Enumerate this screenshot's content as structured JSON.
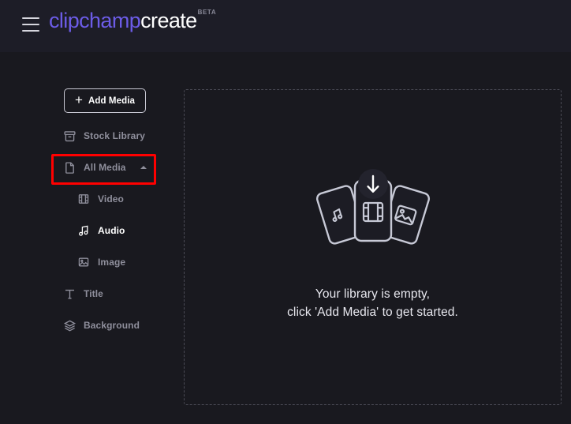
{
  "header": {
    "menu_icon": "hamburger-icon",
    "logo_primary": "clipchamp",
    "logo_secondary": "create",
    "badge": "BETA"
  },
  "sidebar": {
    "add_media": {
      "label": "Add Media",
      "icon": "plus-icon"
    },
    "items": [
      {
        "label": "Stock Library",
        "icon": "archive-icon",
        "level": 0,
        "active": false,
        "caret": false
      },
      {
        "label": "All Media",
        "icon": "file-icon",
        "level": 0,
        "active": false,
        "caret": true
      },
      {
        "label": "Video",
        "icon": "film-icon",
        "level": 1,
        "active": false,
        "caret": false
      },
      {
        "label": "Audio",
        "icon": "music-icon",
        "level": 1,
        "active": true,
        "caret": false
      },
      {
        "label": "Image",
        "icon": "image-icon",
        "level": 1,
        "active": false,
        "caret": false
      },
      {
        "label": "Title",
        "icon": "text-icon",
        "level": 0,
        "active": false,
        "caret": false
      },
      {
        "label": "Background",
        "icon": "layers-icon",
        "level": 0,
        "active": false,
        "caret": false
      }
    ],
    "highlight": {
      "target": "All Media",
      "color": "#ff0000"
    }
  },
  "main": {
    "illustration": "media-cards-upload-illustration",
    "empty_line1": "Your library is empty,",
    "empty_line2": "click 'Add Media' to get started."
  },
  "colors": {
    "header_bg": "#1d1d27",
    "body_bg": "#19191f",
    "accent": "#6c5ce7",
    "muted_text": "#8f8f9c",
    "active_text": "#ffffff",
    "highlight": "#ff0000",
    "dashed_border": "#4a4a55"
  }
}
